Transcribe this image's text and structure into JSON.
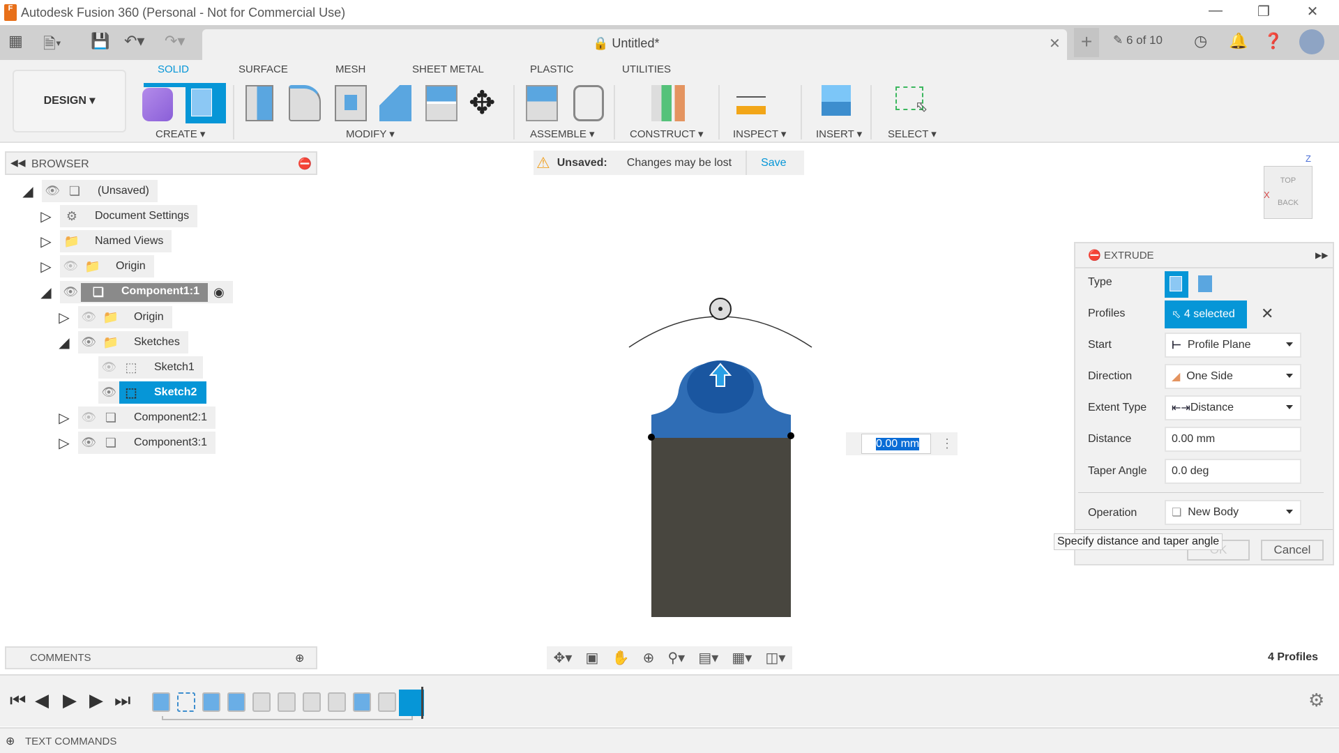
{
  "window": {
    "title": "Autodesk Fusion 360 (Personal - Not for Commercial Use)",
    "app_icon_letter": "F"
  },
  "tabbar": {
    "doc_title": "Untitled*",
    "counter": "6 of 10"
  },
  "toolbar": {
    "workspace": "DESIGN",
    "tabs": [
      "SOLID",
      "SURFACE",
      "MESH",
      "SHEET METAL",
      "PLASTIC",
      "UTILITIES"
    ],
    "groups": [
      "CREATE",
      "MODIFY",
      "ASSEMBLE",
      "CONSTRUCT",
      "INSPECT",
      "INSERT",
      "SELECT"
    ]
  },
  "banner": {
    "title": "Unsaved:",
    "message": "Changes may be lost",
    "save": "Save"
  },
  "browser": {
    "title": "BROWSER",
    "items": [
      {
        "label": "(Unsaved)"
      },
      {
        "label": "Document Settings"
      },
      {
        "label": "Named Views"
      },
      {
        "label": "Origin"
      },
      {
        "label": "Component1:1"
      },
      {
        "label": "Origin"
      },
      {
        "label": "Sketches"
      },
      {
        "label": "Sketch1"
      },
      {
        "label": "Sketch2"
      },
      {
        "label": "Component2:1"
      },
      {
        "label": "Component3:1"
      }
    ]
  },
  "viewport": {
    "distance_input": "0.00 mm",
    "viewcube": {
      "top": "TOP",
      "back": "BACK",
      "x": "X",
      "z": "Z"
    },
    "status": "4 Profiles"
  },
  "extrude": {
    "title": "EXTRUDE",
    "type_label": "Type",
    "profiles_label": "Profiles",
    "profiles_value": "4 selected",
    "start_label": "Start",
    "start_value": "Profile Plane",
    "direction_label": "Direction",
    "direction_value": "One Side",
    "extent_label": "Extent Type",
    "extent_value": "Distance",
    "distance_label": "Distance",
    "distance_value": "0.00 mm",
    "taper_label": "Taper Angle",
    "taper_value": "0.0 deg",
    "operation_label": "Operation",
    "operation_value": "New Body",
    "ok": "OK",
    "cancel": "Cancel",
    "tooltip": "Specify distance and taper angle"
  },
  "comments": {
    "title": "COMMENTS"
  },
  "textcommands": {
    "title": "TEXT COMMANDS"
  },
  "colors": {
    "accent": "#0696d7",
    "body_blue": "#2f6db5",
    "body_dark": "#48463f"
  }
}
